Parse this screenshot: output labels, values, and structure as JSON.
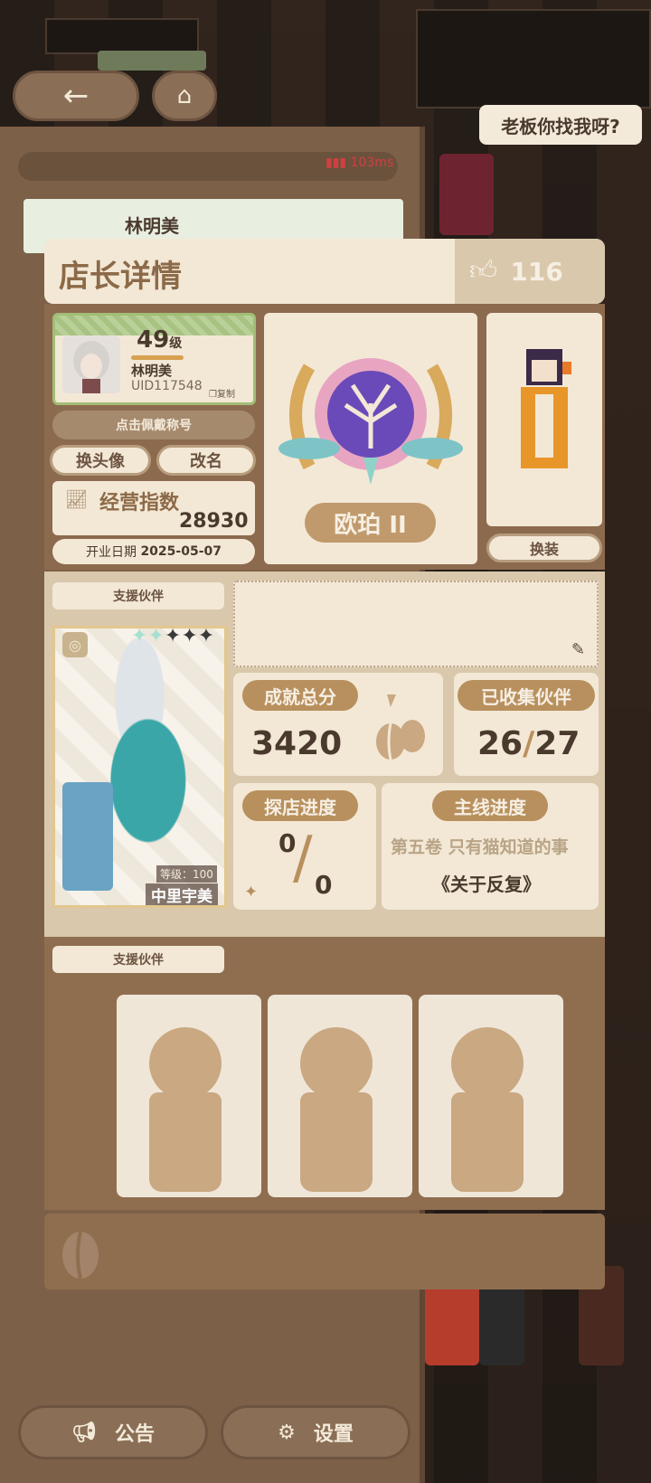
{
  "network": {
    "ping": "103ms"
  },
  "speech_bubble": "老板你找我呀?",
  "underlying_name": "林明美",
  "header": {
    "title": "店长详情",
    "likes": "116"
  },
  "profile": {
    "level": "49",
    "level_unit": "级",
    "name": "林明美",
    "uid": "UID117548",
    "copy_label": "复制",
    "title_button": "点击佩戴称号",
    "change_avatar": "换头像",
    "rename": "改名",
    "business_index_label": "经营指数",
    "business_index_value": "28930",
    "open_date_label": "开业日期",
    "open_date_value": "2025-05-07"
  },
  "rank": {
    "label": "欧珀 II"
  },
  "outfit": {
    "button": "换装"
  },
  "support": {
    "label": "支援伙伴",
    "partner": {
      "level_text": "等级：100",
      "name": "中里宇美",
      "stars": 5
    }
  },
  "stats": {
    "achievement_label": "成就总分",
    "achievement_value": "3420",
    "collected_label": "已收集伙伴",
    "collected_value": "26",
    "collected_total": "27",
    "explore_label": "探店进度",
    "explore_value": "0",
    "explore_total": "0",
    "story_label": "主线进度",
    "story_chapter": "第五卷 只有猫知道的事",
    "story_title": "《关于反复》"
  },
  "support2": {
    "label": "支援伙伴"
  },
  "bottom": {
    "notice": "公告",
    "settings": "设置"
  }
}
